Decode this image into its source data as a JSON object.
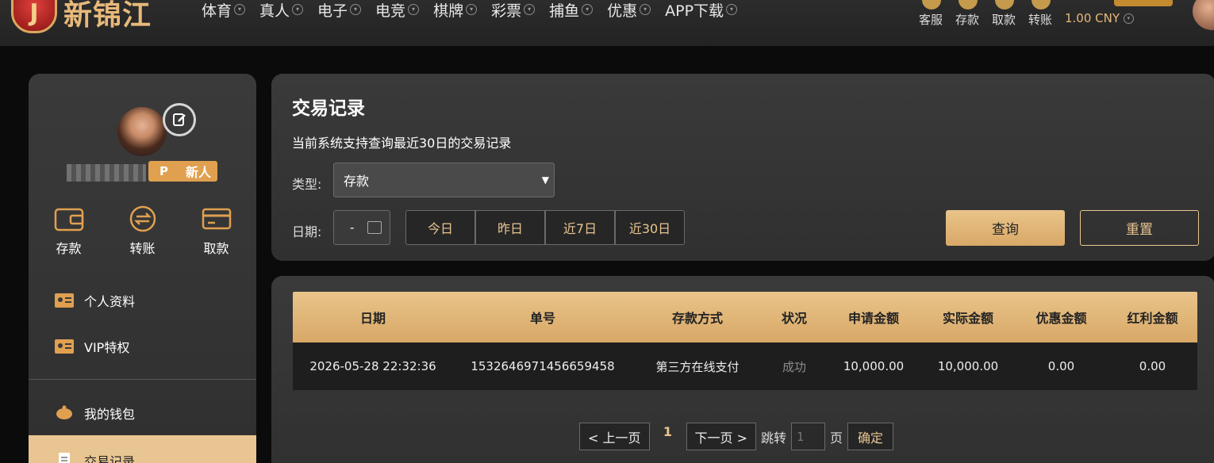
{
  "brand": {
    "name": "新锦江"
  },
  "nav": [
    {
      "label": "体育"
    },
    {
      "label": "真人"
    },
    {
      "label": "电子"
    },
    {
      "label": "电竞"
    },
    {
      "label": "棋牌"
    },
    {
      "label": "彩票"
    },
    {
      "label": "捕鱼"
    },
    {
      "label": "优惠"
    },
    {
      "label": "APP下载"
    }
  ],
  "header_tools": [
    {
      "label": "客服",
      "icon": "chat-icon"
    },
    {
      "label": "存款",
      "icon": "deposit-icon"
    },
    {
      "label": "取款",
      "icon": "withdraw-icon"
    },
    {
      "label": "转账",
      "icon": "transfer-icon"
    }
  ],
  "balance": "1.00 CNY",
  "sidebar": {
    "vip_badge": "新人",
    "vip_prefix": "P",
    "quick_actions": [
      {
        "label": "存款",
        "icon": "wallet-icon"
      },
      {
        "label": "转账",
        "icon": "transfer-icon"
      },
      {
        "label": "取款",
        "icon": "card-icon"
      }
    ],
    "menu": [
      {
        "label": "个人资料",
        "icon": "id-card-icon"
      },
      {
        "label": "VIP特权",
        "icon": "id-card-icon"
      },
      {
        "label": "我的钱包",
        "icon": "piggy-bank-icon"
      },
      {
        "label": "交易记录",
        "icon": "document-icon"
      }
    ]
  },
  "filter": {
    "title": "交易记录",
    "note": "当前系统支持查询最近30日的交易记录",
    "type_label": "类型:",
    "type_value": "存款",
    "date_label": "日期:",
    "date_value": "-",
    "quick_ranges": [
      "今日",
      "昨日",
      "近7日",
      "近30日"
    ],
    "query_label": "查询",
    "reset_label": "重置"
  },
  "table": {
    "headers": [
      "日期",
      "单号",
      "存款方式",
      "状况",
      "申请金额",
      "实际金额",
      "优惠金额",
      "红利金额"
    ],
    "rows": [
      [
        "2026-05-28 22:32:36",
        "1532646971456659458",
        "第三方在线支付",
        "成功",
        "10,000.00",
        "10,000.00",
        "0.00",
        "0.00"
      ]
    ]
  },
  "pagination": {
    "prev": "< 上一页",
    "current": "1",
    "next": "下一页 >",
    "jump_label": "跳转",
    "jump_placeholder": "1",
    "page_unit": "页",
    "confirm": "确定"
  }
}
